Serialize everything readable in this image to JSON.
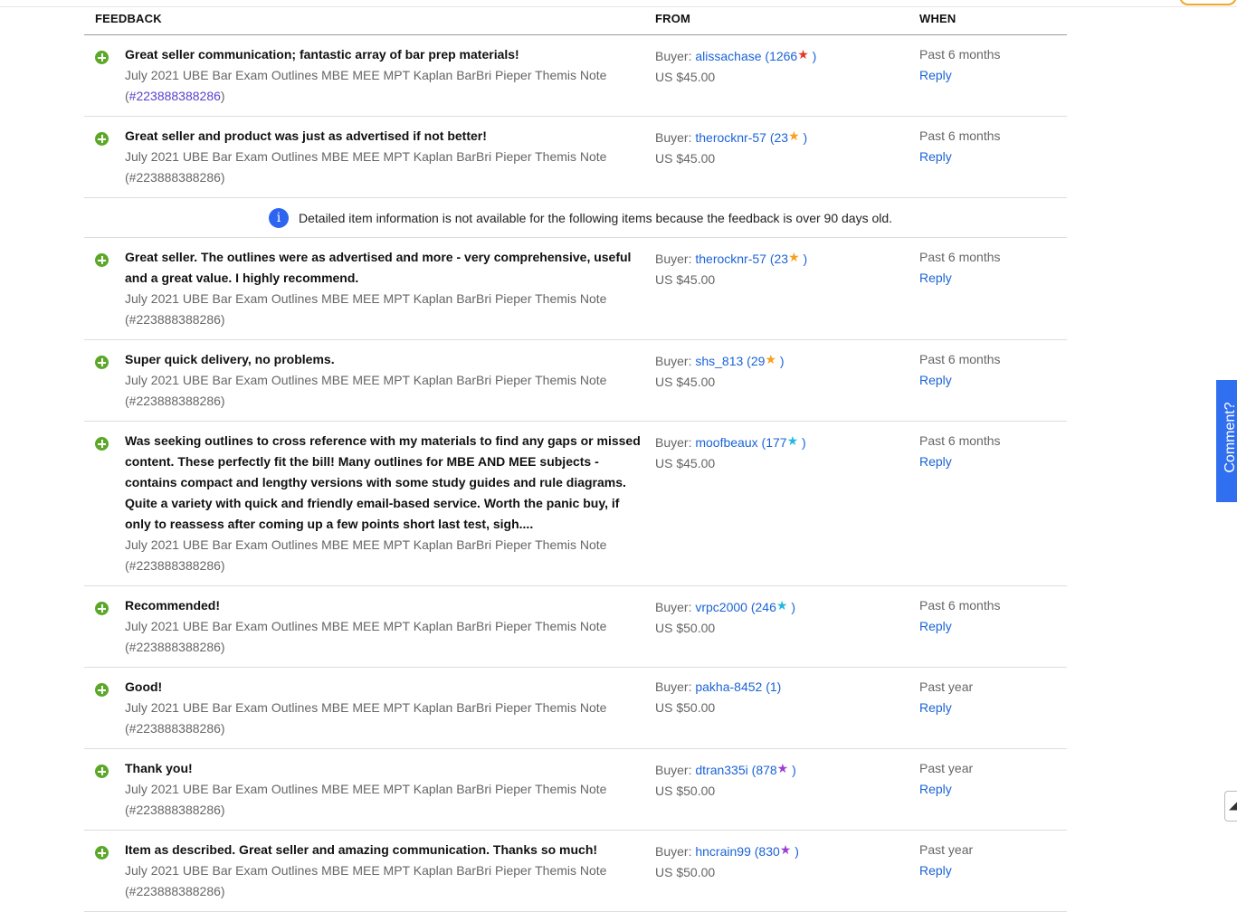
{
  "header": {
    "feedback": "FEEDBACK",
    "from": "FROM",
    "when": "WHEN"
  },
  "info_notice": "Detailed item information is not available for the following items because the feedback is over 90 days old.",
  "reply_label": "Reply",
  "side_tab": "Comment?",
  "star_colors": {
    "red": "#e6352b",
    "orange": "#f5a11c",
    "turquoise": "#22b9e0",
    "purple": "#9b3fd0"
  },
  "rows": [
    {
      "comment": "Great seller communication; fantastic array of bar prep materials!",
      "item": "July 2021 UBE Bar Exam Outlines MBE MEE MPT Kaplan BarBri Pieper Themis Note",
      "item_id": "#223888388286",
      "buyer_label": "Buyer: ",
      "buyer": "alissachase",
      "score": "1266",
      "star": "red",
      "price": "US $45.00",
      "when": "Past 6 months"
    },
    {
      "comment": "Great seller and product was just as advertised if not better!",
      "item": "July 2021 UBE Bar Exam Outlines MBE MEE MPT Kaplan BarBri Pieper Themis Note",
      "item_id": "#223888388286",
      "buyer_label": "Buyer: ",
      "buyer": "therocknr-57",
      "score": "23",
      "star": "orange",
      "price": "US $45.00",
      "when": "Past 6 months"
    },
    {
      "comment": "Great seller. The outlines were as advertised and more - very comprehensive, useful and a great value. I highly recommend.",
      "item": "July 2021 UBE Bar Exam Outlines MBE MEE MPT Kaplan BarBri Pieper Themis Note",
      "item_id": "#223888388286",
      "buyer_label": "Buyer: ",
      "buyer": "therocknr-57",
      "score": "23",
      "star": "orange",
      "price": "US $45.00",
      "when": "Past 6 months"
    },
    {
      "comment": "Super quick delivery, no problems.",
      "item": "July 2021 UBE Bar Exam Outlines MBE MEE MPT Kaplan BarBri Pieper Themis Note",
      "item_id": "#223888388286",
      "buyer_label": "Buyer: ",
      "buyer": "shs_813",
      "score": "29",
      "star": "orange",
      "price": "US $45.00",
      "when": "Past 6 months"
    },
    {
      "comment": "Was seeking outlines to cross reference with my materials to find any gaps or missed content. These perfectly fit the bill! Many outlines for MBE AND MEE subjects - contains compact and lengthy versions with some study guides and rule diagrams. Quite a variety with quick and friendly email-based service. Worth the panic buy, if only to reassess after coming up a few points short last test, sigh....",
      "item": "July 2021 UBE Bar Exam Outlines MBE MEE MPT Kaplan BarBri Pieper Themis Note",
      "item_id": "#223888388286",
      "buyer_label": "Buyer: ",
      "buyer": "moofbeaux",
      "score": "177",
      "star": "turquoise",
      "price": "US $45.00",
      "when": "Past 6 months"
    },
    {
      "comment": "Recommended!",
      "item": "July 2021 UBE Bar Exam Outlines MBE MEE MPT Kaplan BarBri Pieper Themis Note",
      "item_id": "#223888388286",
      "buyer_label": "Buyer: ",
      "buyer": "vrpc2000",
      "score": "246",
      "star": "turquoise",
      "price": "US $50.00",
      "when": "Past 6 months"
    },
    {
      "comment": "Good!",
      "item": "July 2021 UBE Bar Exam Outlines MBE MEE MPT Kaplan BarBri Pieper Themis Note",
      "item_id": "#223888388286",
      "buyer_label": "Buyer: ",
      "buyer": "pakha-8452",
      "score": "1",
      "star": "",
      "price": "US $50.00",
      "when": "Past year"
    },
    {
      "comment": "Thank you!",
      "item": "July 2021 UBE Bar Exam Outlines MBE MEE MPT Kaplan BarBri Pieper Themis Note",
      "item_id": "#223888388286",
      "buyer_label": "Buyer: ",
      "buyer": "dtran335i",
      "score": "878",
      "star": "purple",
      "price": "US $50.00",
      "when": "Past year"
    },
    {
      "comment": "Item as described. Great seller and amazing communication. Thanks so much!",
      "item": "July 2021 UBE Bar Exam Outlines MBE MEE MPT Kaplan BarBri Pieper Themis Note",
      "item_id": "#223888388286",
      "buyer_label": "Buyer: ",
      "buyer": "hncrain99",
      "score": "830",
      "star": "purple",
      "price": "US $50.00",
      "when": "Past year"
    }
  ]
}
